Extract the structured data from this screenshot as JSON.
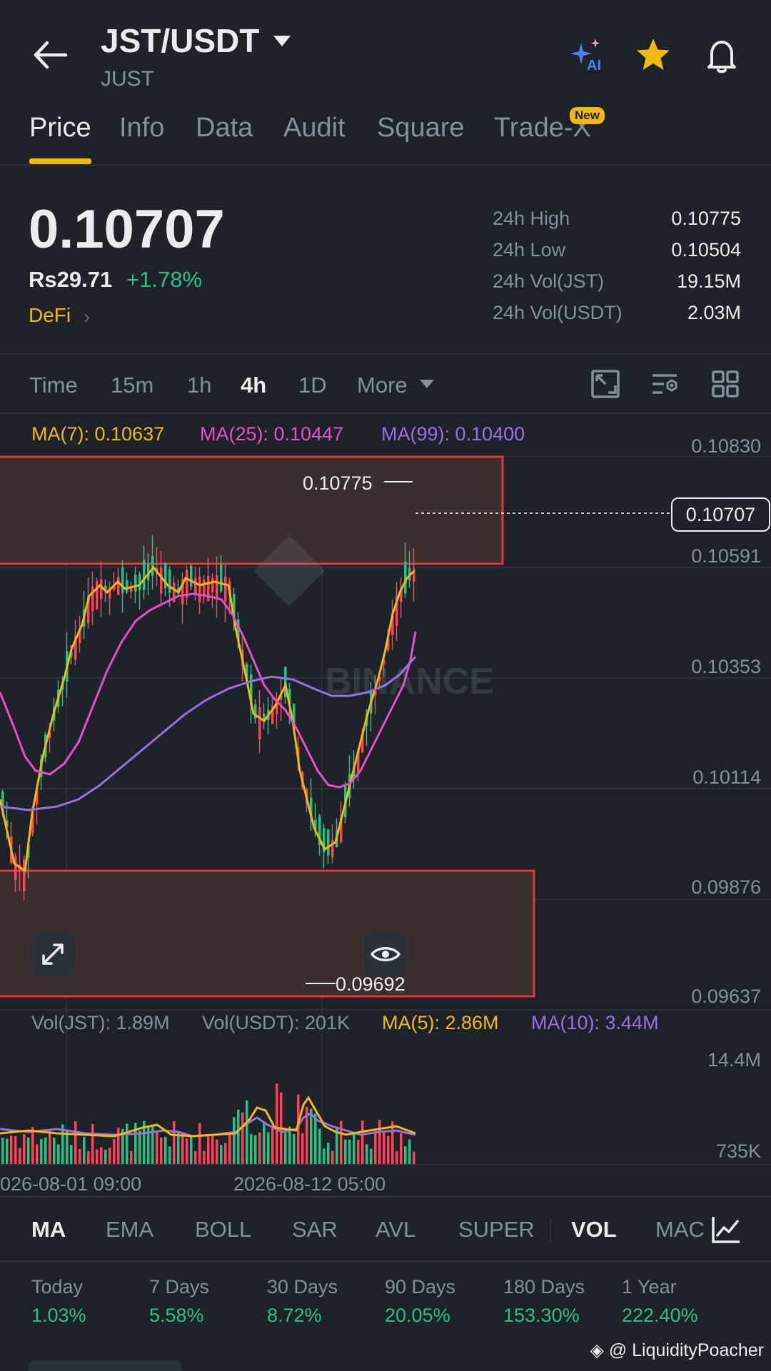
{
  "header": {
    "pair": "JST/USDT",
    "name": "JUST"
  },
  "tabs": [
    {
      "label": "Price",
      "active": true
    },
    {
      "label": "Info"
    },
    {
      "label": "Data"
    },
    {
      "label": "Audit"
    },
    {
      "label": "Square"
    },
    {
      "label": "Trade-X",
      "badge": "New"
    }
  ],
  "ticker": {
    "price": "0.10707",
    "fiat": "Rs29.71",
    "change": "+1.78%",
    "tag": "DeFi",
    "stats": [
      {
        "label": "24h High",
        "value": "0.10775"
      },
      {
        "label": "24h Low",
        "value": "0.10504"
      },
      {
        "label": "24h Vol(JST)",
        "value": "19.15M"
      },
      {
        "label": "24h Vol(USDT)",
        "value": "2.03M"
      }
    ]
  },
  "timeframes": {
    "items": [
      "Time",
      "15m",
      "1h",
      "4h",
      "1D",
      "More"
    ],
    "active": "4h"
  },
  "ma_legend": {
    "ma7": "MA(7): 0.10637",
    "ma25": "MA(25): 0.10447",
    "ma99": "MA(99): 0.10400"
  },
  "price_axis": [
    "0.10830",
    "0.10591",
    "0.10353",
    "0.10114",
    "0.09876",
    "0.09637"
  ],
  "current_price_tag": "0.10707",
  "high_label": "0.10775",
  "low_label": "0.09692",
  "watermark": "BINANCE",
  "volume_legend": {
    "vol_jst": "Vol(JST): 1.89M",
    "vol_usdt": "Vol(USDT): 201K",
    "ma5": "MA(5): 2.86M",
    "ma10": "MA(10): 3.44M"
  },
  "volume_axis": [
    "14.4M",
    "735K"
  ],
  "time_axis": [
    "026-08-01 09:00",
    "2026-08-12 05:00"
  ],
  "indicators": {
    "items": [
      "MA",
      "EMA",
      "BOLL",
      "SAR",
      "AVL",
      "SUPER",
      "VOL",
      "MAC"
    ],
    "active_main": "MA",
    "active_sub": "VOL"
  },
  "performance": [
    {
      "label": "Today",
      "value": "1.03%"
    },
    {
      "label": "7 Days",
      "value": "5.58%"
    },
    {
      "label": "30 Days",
      "value": "8.72%"
    },
    {
      "label": "90 Days",
      "value": "20.05%"
    },
    {
      "label": "180 Days",
      "value": "153.30%"
    },
    {
      "label": "1 Year",
      "value": "222.40%"
    }
  ],
  "credit": "@ LiquidityPoacher",
  "colors": {
    "bg": "#1e2329",
    "up": "#2ebd85",
    "down": "#f6465d",
    "accent": "#f0b90b",
    "ma7": "#f0b90b",
    "ma25": "#e84fc4",
    "ma99": "#9a6fe0"
  },
  "chart_data": {
    "type": "candlestick",
    "price_range": [
      0.09637,
      0.1083
    ],
    "high": 0.10775,
    "low": 0.09692,
    "last": 0.10707,
    "zones": [
      {
        "top": 0.1083,
        "bottom": 0.10591
      },
      {
        "top": 0.0995,
        "bottom": 0.09637
      }
    ]
  }
}
